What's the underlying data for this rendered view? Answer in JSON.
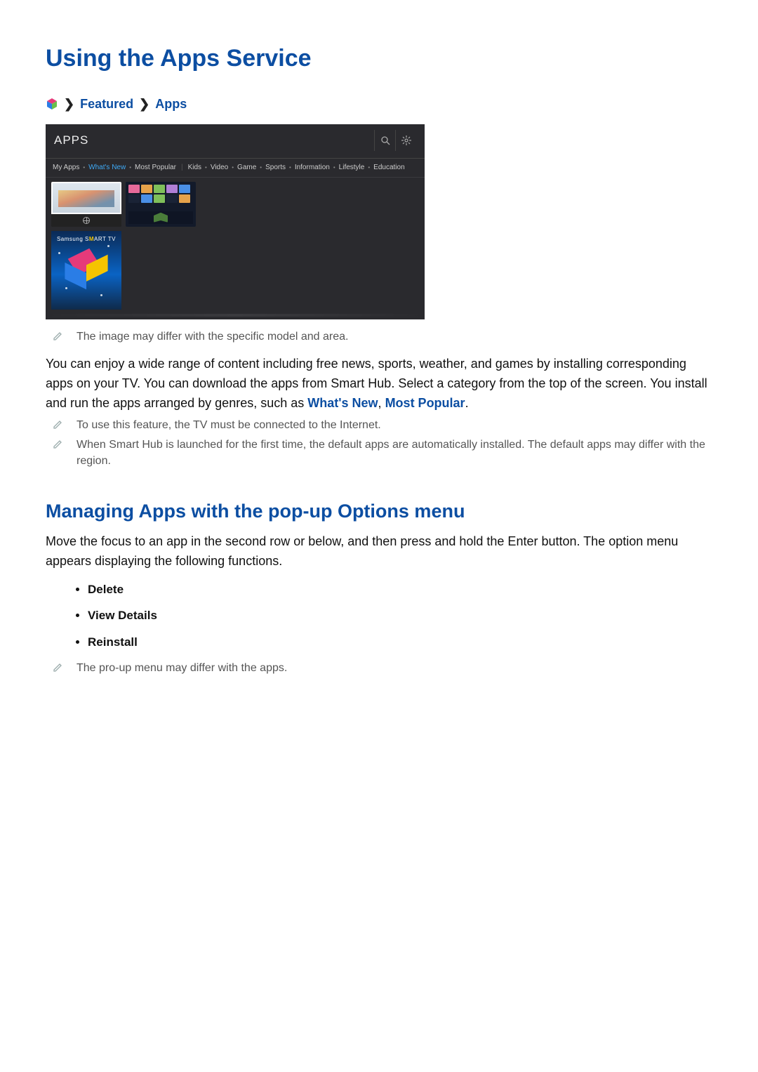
{
  "title": "Using the Apps Service",
  "breadcrumb": {
    "featured": "Featured",
    "apps": "Apps"
  },
  "tv": {
    "title": "APPS",
    "categories": {
      "my_apps": "My Apps",
      "whats_new": "What's New",
      "most_popular": "Most Popular",
      "kids": "Kids",
      "video": "Video",
      "game": "Game",
      "sports": "Sports",
      "information": "Information",
      "lifestyle": "Lifestyle",
      "education": "Education"
    },
    "smart_label_prefix": "Samsung S",
    "smart_label_mid": "M",
    "smart_label_suffix": "ART TV"
  },
  "notes": {
    "differ": "The image may differ with the specific model and area.",
    "internet": "To use this feature, the TV must be connected to the Internet.",
    "default_apps": "When Smart Hub is launched for the first time, the default apps are automatically installed. The default apps may differ with the region.",
    "popup_differ": "The pro-up menu may differ with the apps."
  },
  "body": {
    "p1a": "You can enjoy a wide range of content including free news, sports, weather, and games by installing corresponding apps on your TV. You can download the apps from Smart Hub. Select a category from the top of the screen. You install and run the apps arranged by genres, such as ",
    "whats_new": "What's New",
    "comma": ", ",
    "most_popular": "Most Popular",
    "period": "."
  },
  "subheading": "Managing Apps with the pop-up Options menu",
  "p2": "Move the focus to an app in the second row or below, and then press and hold the Enter button. The option menu appears displaying the following functions.",
  "options": {
    "delete": "Delete",
    "view_details": "View Details",
    "reinstall": "Reinstall"
  }
}
